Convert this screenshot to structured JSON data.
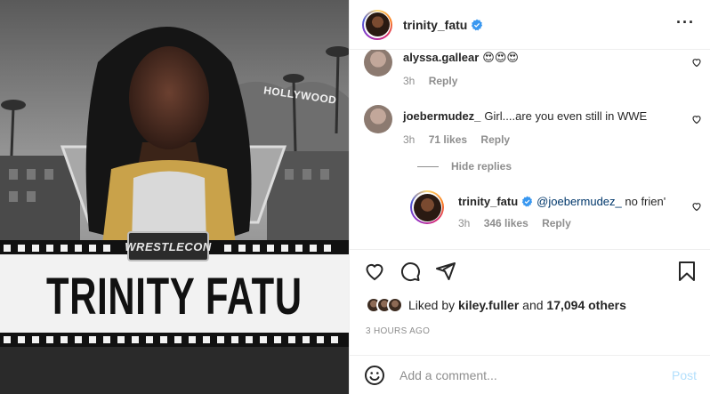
{
  "post_image": {
    "badge_text": "WRESTLECON",
    "poster_title": "TRINITY FATU",
    "sign_text": "HOLLYWOOD"
  },
  "header": {
    "username": "trinity_fatu",
    "more_icon": "more-horizontal-icon"
  },
  "comments": [
    {
      "username": "alyssa.gallear",
      "text": "😍😍😍",
      "time": "3h",
      "reply_label": "Reply"
    },
    {
      "username": "joebermudez_",
      "text": "Girl....are you even still in WWE",
      "time": "3h",
      "likes": "71 likes",
      "reply_label": "Reply"
    }
  ],
  "hide_replies_label": "Hide replies",
  "reply": {
    "username": "trinity_fatu",
    "mention": "@joebermudez_",
    "text": " no frien'",
    "time": "3h",
    "likes": "346 likes",
    "reply_label": "Reply"
  },
  "likes": {
    "prefix": "Liked by ",
    "user": "kiley.fuller",
    "middle": " and ",
    "others": "17,094 others"
  },
  "timestamp": "3 HOURS AGO",
  "add_comment": {
    "placeholder": "Add a comment...",
    "post_label": "Post"
  },
  "colors": {
    "verified": "#3897f0",
    "link": "#00376b",
    "muted": "#8e8e8e",
    "post_disabled": "#b2dffc"
  }
}
